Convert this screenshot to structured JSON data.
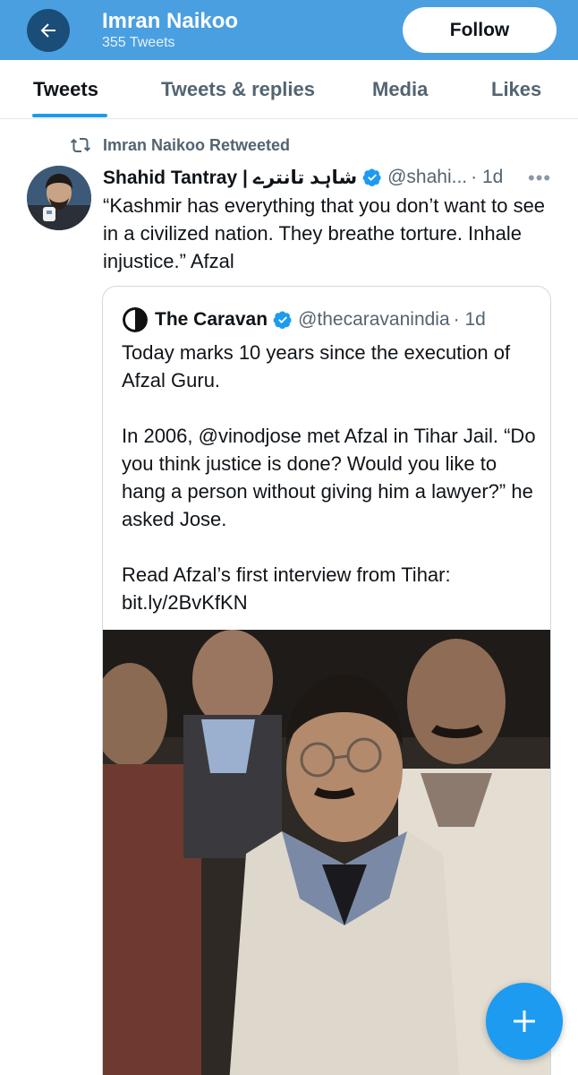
{
  "header": {
    "back_icon": "arrow-left-icon",
    "title": "Imran Naikoo",
    "subtitle": "355 Tweets",
    "follow_label": "Follow",
    "color": "#4a9fe0"
  },
  "tabs": [
    {
      "label": "Tweets",
      "active": true
    },
    {
      "label": "Tweets & replies",
      "active": false
    },
    {
      "label": "Media",
      "active": false
    },
    {
      "label": "Likes",
      "active": false
    }
  ],
  "retweet": {
    "icon": "retweet-icon",
    "text": "Imran Naikoo Retweeted"
  },
  "tweet": {
    "author_name": "Shahid Tantray | شاہد تانترے",
    "handle": "@shahi...",
    "time": "· 1d",
    "more_icon": "more-icon",
    "text": "“Kashmir has everything that you don’t want to see in a civilized nation. They breathe torture. Inhale injustice.” Afzal"
  },
  "quote": {
    "name": "The Caravan",
    "handle": "@thecaravanindia",
    "time": "· 1d",
    "paragraphs": [
      "Today marks 10 years since the execution of Afzal Guru.",
      "In 2006, @vinodjose met Afzal in Tihar Jail. “Do you think justice is done? Would you like to hang a person without giving him a lawyer?” he asked Jose.",
      "Read Afzal’s first interview from Tihar: bit.ly/2BvKfKN"
    ]
  },
  "fab": {
    "icon": "plus-icon",
    "color": "#1d9bf0"
  }
}
